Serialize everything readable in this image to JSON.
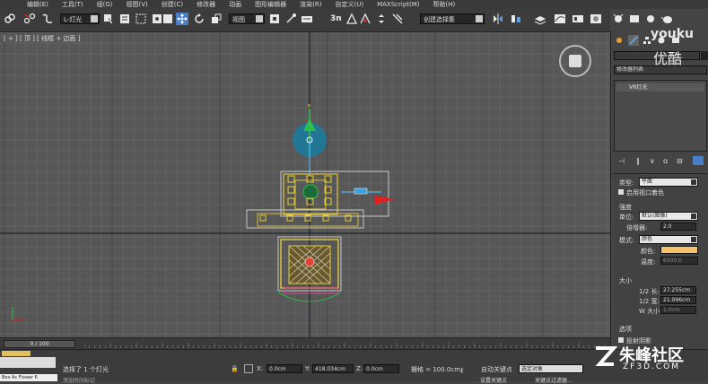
{
  "menu": {
    "items": [
      "编辑(E)",
      "工具(T)",
      "组(G)",
      "视图(V)",
      "创建(C)",
      "修改器",
      "动画",
      "图形编辑器",
      "渲染(R)",
      "自定义(U)",
      "MAXScript(M)",
      "帮助(H)"
    ]
  },
  "toolbar": {
    "selection_filter": "L-灯光",
    "reference_coord": "视图",
    "snap_angle_label": "3n",
    "selection_set": "创建选择集"
  },
  "viewport": {
    "label": "[ + ] [ 顶 ] [ 线框 + 边面 ]",
    "gizmo_axis_label": "Y"
  },
  "command_panel": {
    "modifier_list": "修改器列表",
    "stack_item": "VR灯光",
    "params": {
      "type_label": "类型:",
      "type_value": "平面",
      "enable_viewport_label": "启用视口着色",
      "intensity_header": "强度",
      "units_label": "单位:",
      "units_value": "默认(图像)",
      "multiplier_label": "倍增器:",
      "multiplier_value": "2.0",
      "mode_label": "模式:",
      "mode_value": "颜色",
      "color_label": "颜色:",
      "temperature_label": "温度:",
      "temperature_value": "6500.0",
      "size_header": "大小",
      "half_length_label": "1/2 长:",
      "half_length_value": "27.255cm",
      "half_width_label": "1/2 宽:",
      "half_width_value": "21.996cm",
      "w_size_label": "W 大小",
      "w_size_value": "1.0cm",
      "options_header": "选项",
      "cast_shadows_label": "投射阴影"
    },
    "color_swatch": "#f5c26b"
  },
  "timeline": {
    "frame_indicator": "0 / 100"
  },
  "status": {
    "maxscript_listener": "Box As Flower 6",
    "prompt": "选择了 1 个灯光",
    "x_label": "X:",
    "x_value": "0.0cm",
    "y_label": "Y:",
    "y_value": "418.034cm",
    "z_label": "Z:",
    "z_value": "0.0cm",
    "grid_label": "栅格 = 100.0cm",
    "autokey_label": "自动关键点",
    "selected_dropdown": "选定对象",
    "add_time_tag": "添加时间标记",
    "set_key_label": "设置关键点",
    "key_filters": "关键点过滤器..."
  },
  "watermarks": {
    "youku_en": "youku",
    "youku_cn": "优酷",
    "zf3d_cn": "朱峰社区",
    "zf3d_url": "ZF3D.COM"
  },
  "icons": [
    "select-icon",
    "link-icon",
    "unlink-icon",
    "bind-icon",
    "select-object-icon",
    "select-by-name-icon",
    "rect-selection-icon",
    "window-crossing-icon",
    "move-icon",
    "rotate-icon",
    "scale-icon",
    "pivot-icon",
    "snap-toggle-icon",
    "angle-snap-icon",
    "percent-snap-icon",
    "spinner-snap-icon",
    "mirror-icon",
    "align-icon",
    "layer-icon",
    "curve-editor-icon",
    "schematic-icon",
    "material-editor-icon",
    "render-setup-icon",
    "render-frame-icon",
    "render-icon",
    "teapot-icon"
  ]
}
